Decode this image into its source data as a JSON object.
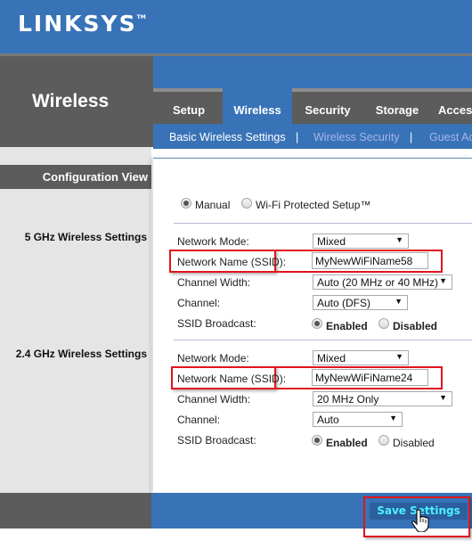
{
  "brand": {
    "logo": "LINKSYS",
    "trademark": "TM"
  },
  "page_title": "Wireless",
  "tabs": [
    {
      "label": "Setup",
      "active": false
    },
    {
      "label": "Wireless",
      "active": true
    },
    {
      "label": "Security",
      "active": false
    },
    {
      "label": "Storage",
      "active": false
    },
    {
      "label": "Acces",
      "active": false
    }
  ],
  "subnav": {
    "items": [
      {
        "label": "Basic Wireless Settings",
        "active": true
      },
      {
        "label": "Wireless Security",
        "active": false
      },
      {
        "label": "Guest Ac",
        "active": false
      }
    ],
    "separator": "|"
  },
  "sidebar": {
    "config_view": "Configuration View",
    "section_5ghz": "5 GHz Wireless Settings",
    "section_24ghz": "2.4 GHz Wireless Settings"
  },
  "config_mode": {
    "options": [
      "Manual",
      "Wi-Fi Protected Setup™"
    ],
    "selected": "Manual"
  },
  "band_5ghz": {
    "network_mode_label": "Network Mode:",
    "network_mode": "Mixed",
    "ssid_label": "Network Name (SSID):",
    "ssid": "MyNewWiFiName58",
    "channel_width_label": "Channel Width:",
    "channel_width": "Auto (20 MHz or 40 MHz)",
    "channel_label": "Channel:",
    "channel": "Auto (DFS)",
    "ssid_broadcast_label": "SSID Broadcast:",
    "broadcast_enabled": "Enabled",
    "broadcast_disabled": "Disabled",
    "broadcast_selected": "Enabled"
  },
  "band_24ghz": {
    "network_mode_label": "Network Mode:",
    "network_mode": "Mixed",
    "ssid_label": "Network Name (SSID):",
    "ssid": "MyNewWiFiName24",
    "channel_width_label": "Channel Width:",
    "channel_width": "20 MHz Only",
    "channel_label": "Channel:",
    "channel": "Auto",
    "ssid_broadcast_label": "SSID Broadcast:",
    "broadcast_enabled": "Enabled",
    "broadcast_disabled": "Disabled",
    "broadcast_selected": "Enabled"
  },
  "footer": {
    "save_label": "Save Settings"
  },
  "colors": {
    "brand_blue": "#3873b7",
    "dark_gray": "#5c5c5c",
    "highlight_red": "#e0141e",
    "save_text": "#4df0ff"
  }
}
